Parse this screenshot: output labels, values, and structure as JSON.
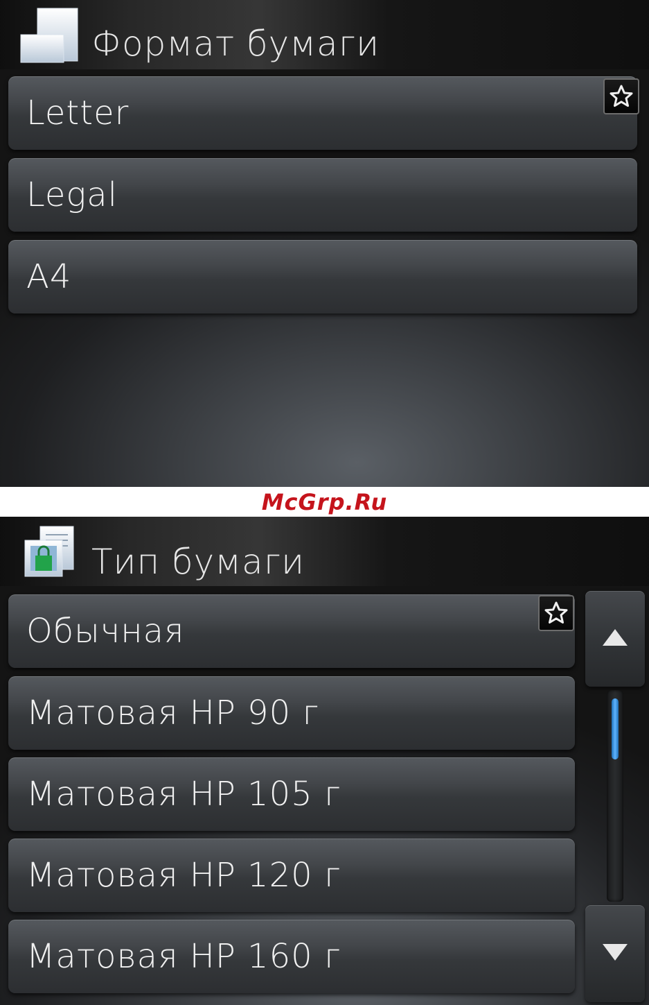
{
  "screen1": {
    "title": "Формат бумаги",
    "title_icon": "paper-size-icon",
    "items": [
      {
        "label": "Letter",
        "favorite": true
      },
      {
        "label": "Legal",
        "favorite": false
      },
      {
        "label": "A4",
        "favorite": false
      }
    ]
  },
  "watermark": {
    "text": "McGrp.Ru",
    "color": "#c5141c"
  },
  "screen2": {
    "title": "Тип бумаги",
    "title_icon": "paper-type-icon",
    "items": [
      {
        "label": "Обычная",
        "favorite": true
      },
      {
        "label": "Матовая HP 90 г",
        "favorite": false
      },
      {
        "label": "Матовая HP 105 г",
        "favorite": false
      },
      {
        "label": "Матовая HP 120 г",
        "favorite": false
      },
      {
        "label": "Матовая HP 160 г",
        "favorite": false
      }
    ],
    "scrollbar": {
      "up_icon": "arrow-up-icon",
      "down_icon": "arrow-down-icon",
      "accent": "#5fb4ff"
    }
  },
  "icons": {
    "favorite": "star-icon"
  }
}
